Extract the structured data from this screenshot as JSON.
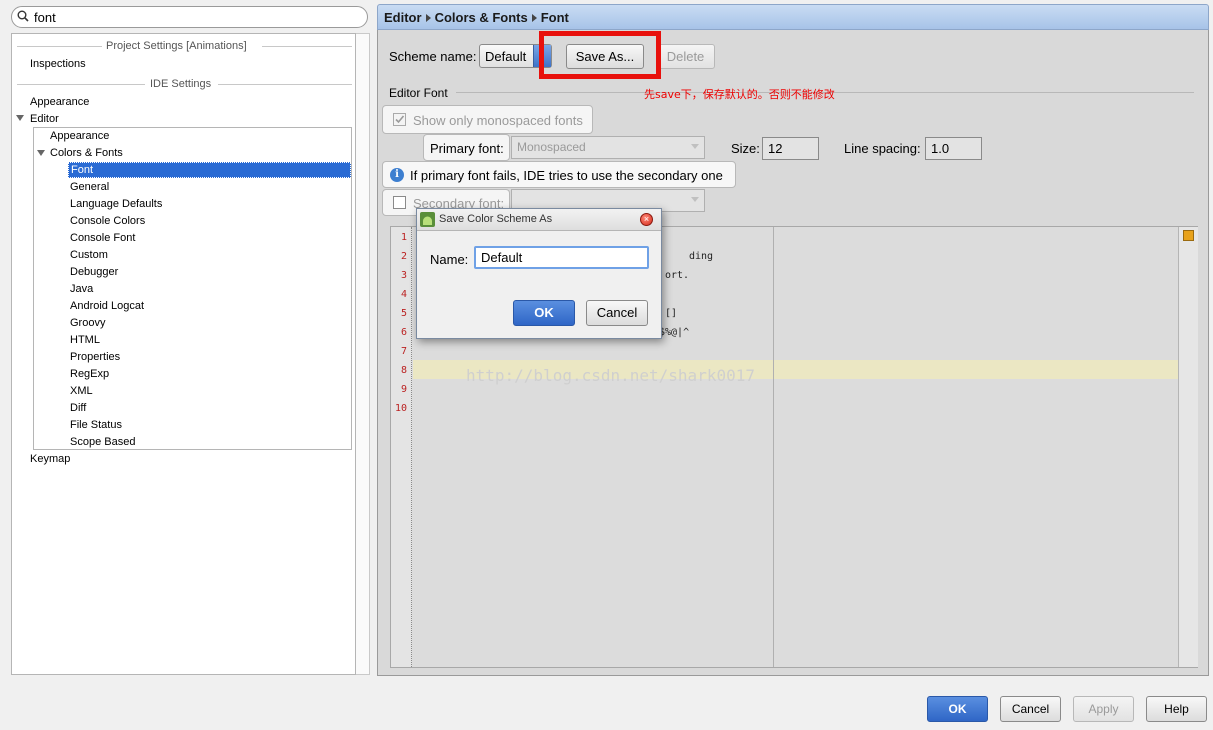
{
  "search": {
    "value": "font"
  },
  "tree": {
    "sections": {
      "project": "Project Settings [Animations]",
      "ide": "IDE Settings"
    },
    "inspections": "Inspections",
    "appearance": "Appearance",
    "editor": "Editor",
    "editor_children": {
      "appearance": "Appearance",
      "colors_fonts": "Colors & Fonts"
    },
    "cf_children": [
      "Font",
      "General",
      "Language Defaults",
      "Console Colors",
      "Console Font",
      "Custom",
      "Debugger",
      "Java",
      "Android Logcat",
      "Groovy",
      "HTML",
      "Properties",
      "RegExp",
      "XML",
      "Diff",
      "File Status",
      "Scope Based"
    ],
    "keymap": "Keymap"
  },
  "breadcrumb": [
    "Editor",
    "Colors & Fonts",
    "Font"
  ],
  "scheme": {
    "label": "Scheme name:",
    "value": "Default",
    "save_as": "Save As...",
    "delete": "Delete"
  },
  "editor_font": {
    "section": "Editor Font",
    "show_mono": "Show only monospaced fonts",
    "primary_label": "Primary font:",
    "primary_value": "Monospaced",
    "size_label": "Size:",
    "size_value": "12",
    "spacing_label": "Line spacing:",
    "spacing_value": "1.0",
    "hint": "If primary font fails, IDE tries to use the secondary one",
    "secondary_label": "Secondary font:"
  },
  "preview": {
    "line_numbers": [
      "1",
      "2",
      "3",
      "4",
      "5",
      "6",
      "7",
      "8",
      "9",
      "10"
    ],
    "fragments": [
      "ding",
      "ort.",
      "[]",
      "$%@|^"
    ]
  },
  "dialog": {
    "title": "Save Color Scheme As",
    "name_label": "Name:",
    "name_value": "Default",
    "ok": "OK",
    "cancel": "Cancel"
  },
  "annotation": "先save下，保存默认的。否则不能修改",
  "watermark": "http://blog.csdn.net/shark0017",
  "footer": {
    "ok": "OK",
    "cancel": "Cancel",
    "apply": "Apply",
    "help": "Help"
  },
  "colors": {
    "accent": "#2a6bd4",
    "annotation_red": "#e8100c"
  }
}
